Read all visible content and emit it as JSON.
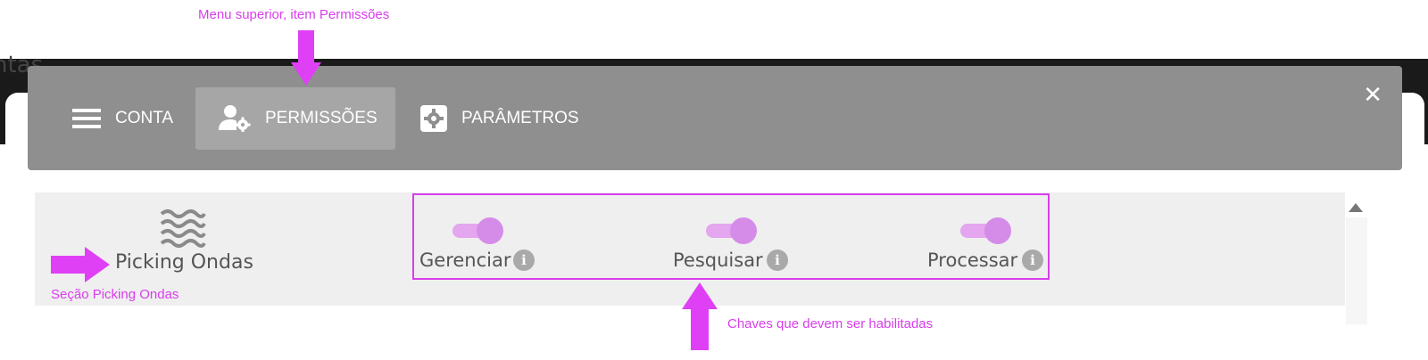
{
  "annotations": {
    "top_menu": "Menu superior, item Permissões",
    "section": "Seção Picking Ondas",
    "toggles": "Chaves que devem ser habilitadas"
  },
  "background": {
    "partial_text": "ntas"
  },
  "topbar": {
    "tabs": [
      {
        "label": "CONTA",
        "icon": "hamburger-menu-icon",
        "active": false
      },
      {
        "label": "PERMISSÕES",
        "icon": "user-gear-icon",
        "active": true
      },
      {
        "label": "PARÂMETROS",
        "icon": "settings-gear-icon",
        "active": false
      }
    ],
    "close_icon": "✕"
  },
  "section": {
    "title": "Picking Ondas",
    "icon": "waves-icon",
    "permissions": [
      {
        "label": "Gerenciar",
        "enabled": true,
        "info": "i"
      },
      {
        "label": "Pesquisar",
        "enabled": true,
        "info": "i"
      },
      {
        "label": "Processar",
        "enabled": true,
        "info": "i"
      }
    ]
  },
  "colors": {
    "annotation": "#d93ded",
    "topbar": "#8f8f8f",
    "active_tab": "#a6a6a6",
    "toggle_on": "#d58ce8"
  }
}
